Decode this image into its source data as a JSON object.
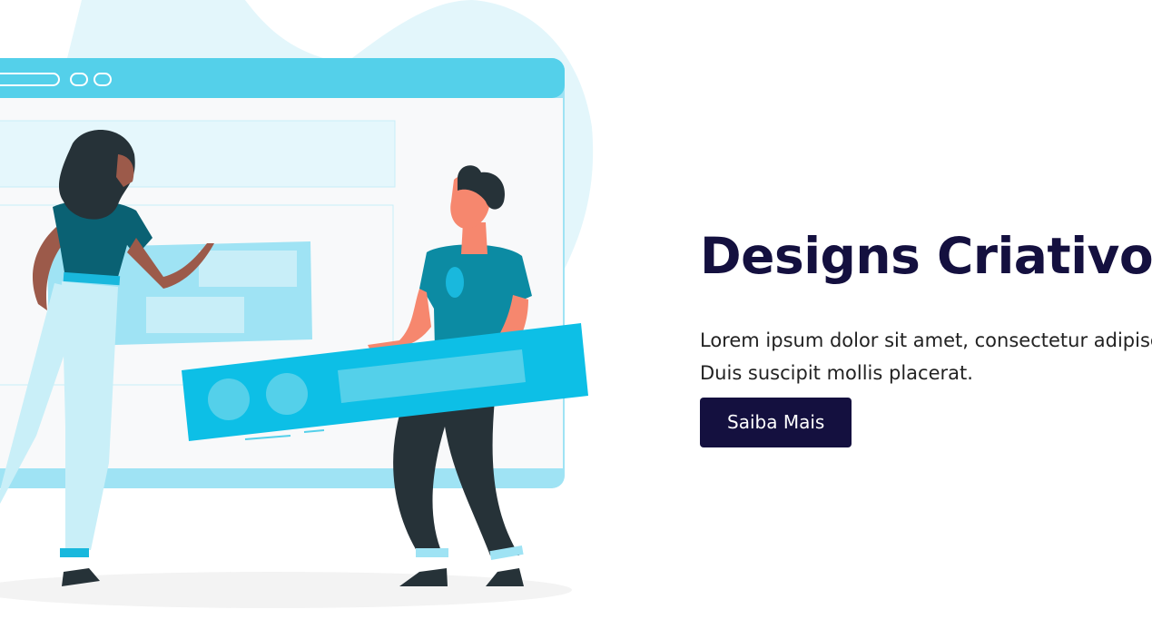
{
  "hero": {
    "title": "Designs Criativos",
    "description_line1": "Lorem ipsum dolor sit amet, consectetur adipiscing elit.",
    "description_line2": "Duis suscipit mollis placerat.",
    "cta_label": "Saiba Mais"
  },
  "colors": {
    "title": "#14103f",
    "button_bg": "#14103f",
    "button_text": "#ffffff",
    "illustration_accent": "#54d0ea",
    "illustration_dark_teal": "#0a6173"
  },
  "illustration": {
    "icon": "team-designing-webpage-illustration"
  }
}
